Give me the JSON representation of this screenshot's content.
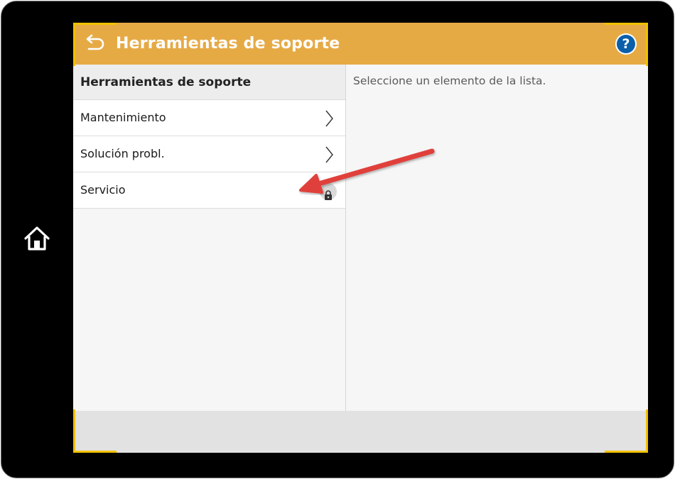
{
  "header": {
    "title": "Herramientas de soporte",
    "color": "#e6aa45",
    "back_icon": "back-arrow-icon",
    "help_label": "?"
  },
  "sidebar": {
    "header": "Herramientas de soporte",
    "items": [
      {
        "label": "Mantenimiento",
        "icon": "chevron-right-icon"
      },
      {
        "label": "Solución probl.",
        "icon": "chevron-right-icon"
      },
      {
        "label": "Servicio",
        "icon": "lock-icon"
      }
    ]
  },
  "detail": {
    "hint": "Seleccione un elemento de la lista."
  },
  "annotation": {
    "type": "arrow",
    "color": "#e0403a"
  },
  "device": {
    "home_icon": "home-icon",
    "accent_color": "#f2c100"
  }
}
